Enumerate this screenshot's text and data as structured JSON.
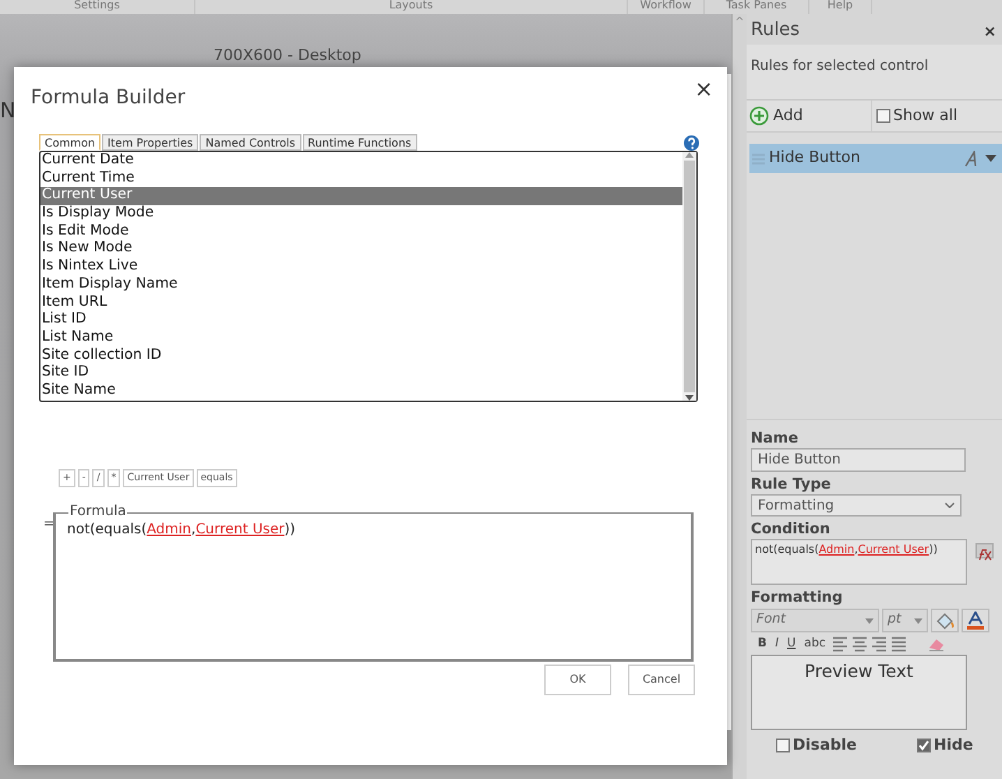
{
  "menu_bar": [
    {
      "label": "Settings"
    },
    {
      "label": "Layouts"
    },
    {
      "label": "Workflow"
    },
    {
      "label": "Task Panes"
    },
    {
      "label": "Help"
    }
  ],
  "canvas": {
    "title": "700X600 - Desktop",
    "fragment": "N"
  },
  "dialog": {
    "title": "Formula Builder",
    "close": "×",
    "tabs": [
      {
        "label": "Common",
        "selected": true
      },
      {
        "label": "Item Properties",
        "selected": false
      },
      {
        "label": "Named Controls",
        "selected": false
      },
      {
        "label": "Runtime Functions",
        "selected": false
      }
    ],
    "items": [
      {
        "label": "Current Date",
        "selected": false
      },
      {
        "label": "Current Time",
        "selected": false
      },
      {
        "label": "Current User",
        "selected": true
      },
      {
        "label": "Is Display Mode",
        "selected": false
      },
      {
        "label": "Is Edit Mode",
        "selected": false
      },
      {
        "label": "Is New Mode",
        "selected": false
      },
      {
        "label": "Is Nintex Live",
        "selected": false
      },
      {
        "label": "Item Display Name",
        "selected": false
      },
      {
        "label": "Item URL",
        "selected": false
      },
      {
        "label": "List ID",
        "selected": false
      },
      {
        "label": "List Name",
        "selected": false
      },
      {
        "label": "Site collection ID",
        "selected": false
      },
      {
        "label": "Site ID",
        "selected": false
      },
      {
        "label": "Site Name",
        "selected": false
      }
    ],
    "operators": [
      "+",
      "-",
      "/",
      "*",
      "Current User",
      "equals"
    ],
    "equals_sign": "=",
    "formula": {
      "legend": "Formula",
      "expression": {
        "prefix": "not(equals(",
        "arguments": [
          "Admin",
          "Current User"
        ],
        "separator": ",",
        "suffix": "))"
      }
    },
    "buttons": [
      "OK",
      "Cancel"
    ]
  },
  "rules_panel": {
    "collapse": "^",
    "title": "Rules",
    "close": "×",
    "description": "Rules for selected control",
    "add_label": "Add",
    "show_all": {
      "label": "Show all",
      "checked": false
    },
    "rules": [
      {
        "label": "Hide Button",
        "selected": true
      }
    ],
    "properties": {
      "name_label": "Name",
      "name_value": "Hide Button",
      "rule_type_label": "Rule Type",
      "rule_type_value": "Formatting",
      "condition_label": "Condition",
      "condition": {
        "prefix": "not(equals(",
        "arguments": [
          "Admin",
          "Current User"
        ],
        "separator": ",",
        "suffix": "))"
      },
      "formatting_label": "Formatting",
      "font_placeholder": "Font",
      "size_placeholder": "pt",
      "style_buttons": [
        "B",
        "I",
        "U",
        "abc"
      ],
      "preview": "Preview Text",
      "options": [
        {
          "label": "Disable",
          "checked": false
        },
        {
          "label": "Hide",
          "checked": true
        }
      ]
    }
  }
}
